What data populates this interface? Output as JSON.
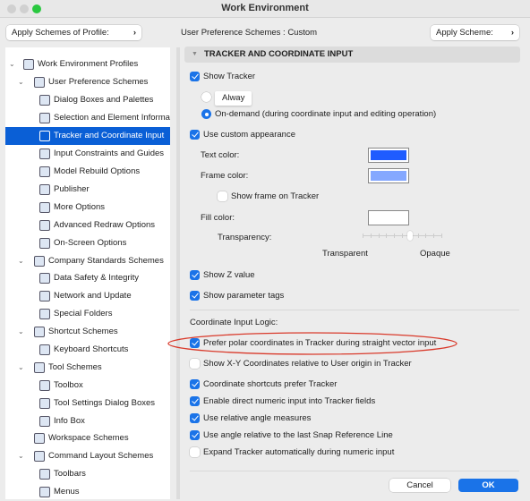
{
  "window": {
    "title": "Work Environment"
  },
  "left": {
    "apply_profile": "Apply Schemes of Profile:"
  },
  "header": {
    "scheme_label": "User Preference Schemes : Custom",
    "apply_scheme": "Apply Scheme:"
  },
  "tree": [
    {
      "label": "Work Environment Profiles",
      "level": 0,
      "expanded": true,
      "icon": "profiles-icon"
    },
    {
      "label": "User Preference Schemes",
      "level": 1,
      "expanded": true,
      "icon": "user-preferences-icon"
    },
    {
      "label": "Dialog Boxes and Palettes",
      "level": 2,
      "icon": "dialog-boxes-icon"
    },
    {
      "label": "Selection and Element Information",
      "level": 2,
      "icon": "selection-info-icon"
    },
    {
      "label": "Tracker and Coordinate Input",
      "level": 2,
      "icon": "tracker-icon",
      "selected": true
    },
    {
      "label": "Input Constraints and Guides",
      "level": 2,
      "icon": "cursor-icon"
    },
    {
      "label": "Model Rebuild Options",
      "level": 2,
      "icon": "model-rebuild-icon"
    },
    {
      "label": "Publisher",
      "level": 2,
      "icon": "publisher-icon"
    },
    {
      "label": "More Options",
      "level": 2,
      "icon": "sliders-icon"
    },
    {
      "label": "Advanced Redraw Options",
      "level": 2,
      "icon": "redraw-icon"
    },
    {
      "label": "On-Screen Options",
      "level": 2,
      "icon": "on-screen-icon"
    },
    {
      "label": "Company Standards Schemes",
      "level": 1,
      "expanded": true,
      "icon": "company-standards-icon"
    },
    {
      "label": "Data Safety & Integrity",
      "level": 2,
      "icon": "data-safety-icon"
    },
    {
      "label": "Network and Update",
      "level": 2,
      "icon": "globe-icon"
    },
    {
      "label": "Special Folders",
      "level": 2,
      "icon": "folder-icon"
    },
    {
      "label": "Shortcut Schemes",
      "level": 1,
      "expanded": true,
      "icon": "shortcut-schemes-icon"
    },
    {
      "label": "Keyboard Shortcuts",
      "level": 2,
      "icon": "keyboard-icon"
    },
    {
      "label": "Tool Schemes",
      "level": 1,
      "expanded": true,
      "icon": "tool-schemes-icon"
    },
    {
      "label": "Toolbox",
      "level": 2,
      "icon": "toolbox-icon"
    },
    {
      "label": "Tool Settings Dialog Boxes",
      "level": 2,
      "icon": "tool-settings-icon"
    },
    {
      "label": "Info Box",
      "level": 2,
      "icon": "info-box-icon"
    },
    {
      "label": "Workspace Schemes",
      "level": 1,
      "icon": "workspace-icon"
    },
    {
      "label": "Command Layout Schemes",
      "level": 1,
      "expanded": true,
      "icon": "command-layout-icon"
    },
    {
      "label": "Toolbars",
      "level": 2,
      "icon": "toolbars-icon"
    },
    {
      "label": "Menus",
      "level": 2,
      "icon": "menus-icon"
    }
  ],
  "section": {
    "title": "TRACKER AND COORDINATE INPUT"
  },
  "tracker": {
    "show_tracker": {
      "label": "Show Tracker",
      "checked": true
    },
    "mode": {
      "always": "Alway",
      "on_demand": "On-demand (during coordinate input and editing operation)",
      "selected": "on_demand"
    },
    "custom_appearance": {
      "label": "Use custom appearance",
      "checked": true
    },
    "text_color": {
      "label": "Text color:",
      "color": "#1f5cff"
    },
    "frame_color": {
      "label": "Frame color:",
      "color": "#85a8ff"
    },
    "show_frame": {
      "label": "Show frame on Tracker",
      "checked": false
    },
    "fill_color": {
      "label": "Fill color:",
      "color": "#ffffff"
    },
    "transparency": {
      "label": "Transparency:",
      "min_label": "Transparent",
      "max_label": "Opaque",
      "value_fraction": 0.6
    },
    "show_z": {
      "label": "Show Z value",
      "checked": true
    },
    "show_params": {
      "label": "Show parameter tags",
      "checked": true
    }
  },
  "logic": {
    "title": "Coordinate Input Logic:",
    "options": [
      {
        "label": "Prefer polar coordinates in Tracker during straight vector input",
        "checked": true,
        "highlighted": true
      },
      {
        "label": "Show X-Y Coordinates relative to User origin in Tracker",
        "checked": false
      },
      {
        "label": "Coordinate shortcuts prefer Tracker",
        "checked": true
      },
      {
        "label": "Enable direct numeric input into Tracker fields",
        "checked": true
      },
      {
        "label": "Use relative angle measures",
        "checked": true
      },
      {
        "label": "Use angle relative to the last Snap Reference Line",
        "checked": true
      },
      {
        "label": "Expand Tracker automatically during numeric input",
        "checked": false
      }
    ]
  },
  "footer": {
    "cancel": "Cancel",
    "ok": "OK"
  },
  "colors": {
    "accent": "#1a73e8",
    "selection": "#0a5fd6",
    "highlight_ellipse": "#d93a2b"
  }
}
